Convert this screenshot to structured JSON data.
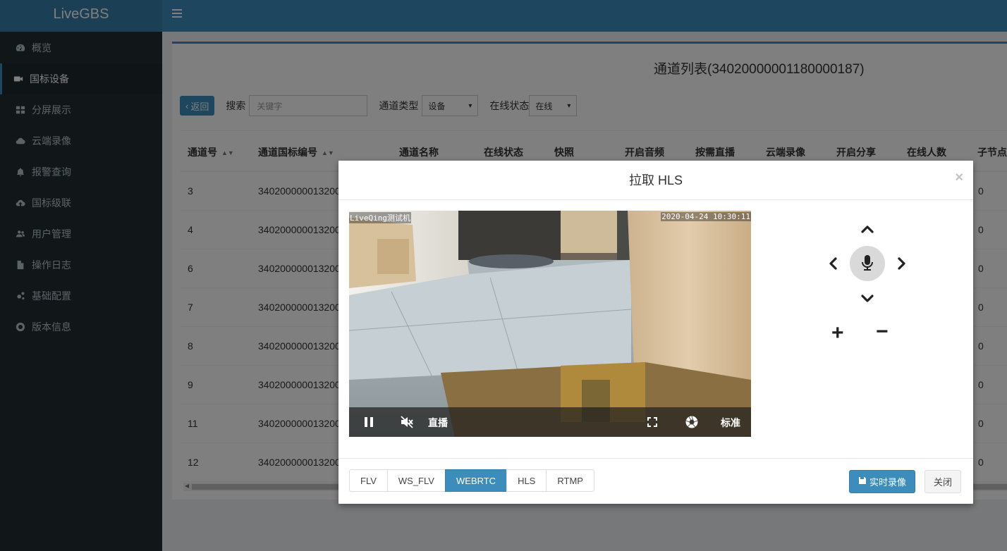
{
  "app": {
    "name": "LiveGBS"
  },
  "colors": {
    "primary": "#3c8dbc",
    "sidebar": "#222d32",
    "sidebar_text": "#b8c7ce"
  },
  "sidebar": {
    "items": [
      {
        "label": "概览",
        "icon": "dashboard-icon",
        "active": false
      },
      {
        "label": "国标设备",
        "icon": "video-camera-icon",
        "active": true
      },
      {
        "label": "分屏展示",
        "icon": "grid-icon",
        "active": false
      },
      {
        "label": "云端录像",
        "icon": "cloud-icon",
        "active": false
      },
      {
        "label": "报警查询",
        "icon": "bell-icon",
        "active": false
      },
      {
        "label": "国标级联",
        "icon": "cloud-upload-icon",
        "active": false
      },
      {
        "label": "用户管理",
        "icon": "users-icon",
        "active": false
      },
      {
        "label": "操作日志",
        "icon": "file-icon",
        "active": false
      },
      {
        "label": "基础配置",
        "icon": "gears-icon",
        "active": false
      },
      {
        "label": "版本信息",
        "icon": "life-ring-icon",
        "active": false
      }
    ]
  },
  "header": {
    "toggle_icon": "hamburger-icon"
  },
  "page": {
    "title": "通道列表(34020000001180000187)",
    "toolbar": {
      "back_label": "返回",
      "search_label": "搜索",
      "search_placeholder": "关键字",
      "channel_type_label": "通道类型",
      "channel_type_value": "设备",
      "online_status_label": "在线状态",
      "online_status_value": "在线"
    },
    "table": {
      "columns": [
        "通道号",
        "通道国标编号",
        "通道名称",
        "在线状态",
        "快照",
        "开启音频",
        "按需直播",
        "云端录像",
        "开启分享",
        "在线人数",
        "子节点"
      ],
      "rows": [
        {
          "channel": "3",
          "gb_id": "340200000013200",
          "children": "0"
        },
        {
          "channel": "4",
          "gb_id": "340200000013200",
          "children": "0"
        },
        {
          "channel": "6",
          "gb_id": "340200000013200",
          "children": "0"
        },
        {
          "channel": "7",
          "gb_id": "340200000013200",
          "children": "0"
        },
        {
          "channel": "8",
          "gb_id": "340200000013200",
          "children": "0"
        },
        {
          "channel": "9",
          "gb_id": "340200000013200",
          "children": "0"
        },
        {
          "channel": "11",
          "gb_id": "340200000013200",
          "children": "0"
        },
        {
          "channel": "12",
          "gb_id": "340200000013200",
          "children": "0"
        }
      ]
    }
  },
  "modal": {
    "title": "拉取 HLS",
    "close_glyph": "×",
    "video": {
      "osd_name": "LiveQing测试机",
      "osd_time": "2020-04-24 10:30:11",
      "live_label": "直播",
      "quality_label": "标准"
    },
    "protocols": [
      {
        "label": "FLV",
        "active": false
      },
      {
        "label": "WS_FLV",
        "active": false
      },
      {
        "label": "WEBRTC",
        "active": true
      },
      {
        "label": "HLS",
        "active": false
      },
      {
        "label": "RTMP",
        "active": false
      }
    ],
    "record_label": "实时录像",
    "close_label": "关闭"
  }
}
